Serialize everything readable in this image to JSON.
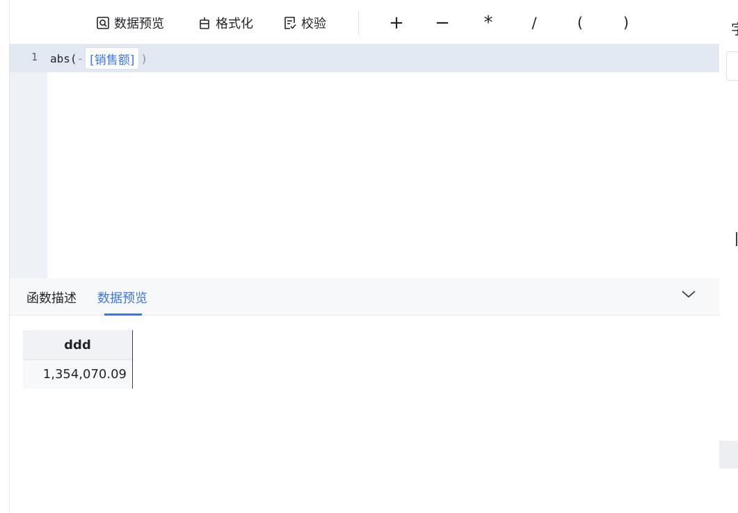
{
  "toolbar": {
    "preview_label": "数据预览",
    "format_label": "格式化",
    "validate_label": "校验",
    "operators": [
      "+",
      "−",
      "*",
      "/",
      "(",
      ")"
    ]
  },
  "editor": {
    "line_number": "1",
    "code_prefix": "abs(",
    "code_minus": "-",
    "field_token": "[销售额]",
    "code_suffix": ")"
  },
  "tabs": {
    "items": [
      "函数描述",
      "数据预览"
    ],
    "active_index": 1
  },
  "preview_table": {
    "columns": [
      "ddd"
    ],
    "rows": [
      [
        "1,354,070.09"
      ]
    ]
  },
  "right_panel": {
    "title_fragment": "字"
  },
  "colors": {
    "accent": "#3b74e8",
    "active_line": "#e2e8f2",
    "gutter": "#eef1f6"
  }
}
